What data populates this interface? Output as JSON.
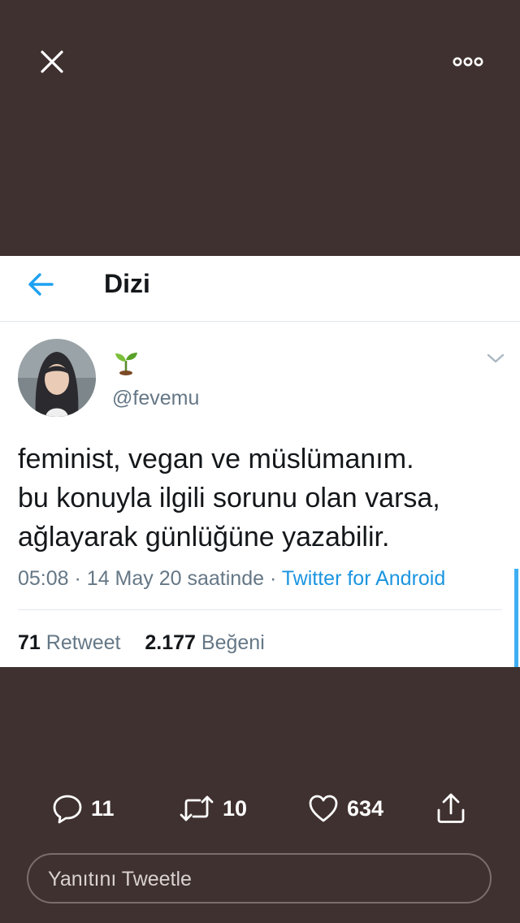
{
  "top_bar": {
    "close_icon": "close-icon",
    "more_icon": "more-options-icon"
  },
  "header": {
    "back_icon": "back-arrow-icon",
    "title": "Dizi"
  },
  "tweet": {
    "name_emoji": "seedling-emoji",
    "handle": "@fevemu",
    "text_lines": [
      "feminist, vegan ve müslümanım.",
      "bu konuyla ilgili sorunu olan varsa,",
      "ağlayarak günlüğüne yazabilir."
    ],
    "time": "05:08",
    "date": "14 May 20 saatinde",
    "separator": "·",
    "source": "Twitter for Android",
    "retweet_count": "71",
    "retweet_label": "Retweet",
    "like_count": "2.177",
    "like_label": "Beğeni"
  },
  "actions": {
    "replies": "11",
    "retweets": "10",
    "likes": "634"
  },
  "reply_box": {
    "placeholder": "Yanıtını Tweetle"
  },
  "colors": {
    "background": "#3f312f",
    "accent": "#1da1f2",
    "link": "#1b95e0",
    "secondary_text": "#657786"
  }
}
